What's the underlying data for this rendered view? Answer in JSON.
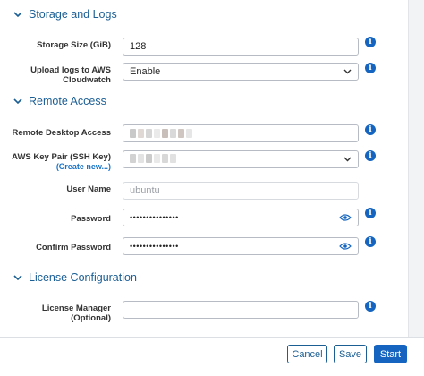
{
  "sections": {
    "storage": "Storage and Logs",
    "remote": "Remote Access",
    "license": "License Configuration"
  },
  "storage": {
    "size_label": "Storage Size (GiB)",
    "size_value": "128",
    "cloudwatch_label": "Upload logs to AWS Cloudwatch",
    "cloudwatch_value": "Enable"
  },
  "remote": {
    "rda_label": "Remote Desktop Access",
    "keypair_label": "AWS Key Pair (SSH Key)",
    "keypair_create": "(Create new...)",
    "username_label": "User Name",
    "username_value": "ubuntu",
    "password_label": "Password",
    "password_value": "•••••••••••••••",
    "confirm_label": "Confirm Password",
    "confirm_value": "•••••••••••••••"
  },
  "license": {
    "manager_label": "License Manager (Optional)",
    "manager_value": ""
  },
  "footer": {
    "cancel": "Cancel",
    "save": "Save",
    "start": "Start"
  },
  "info_glyph": "i",
  "colors": {
    "accent": "#1565c0",
    "section_title": "#1b5e94",
    "link": "#1a73c7"
  },
  "icons": [
    "chevron-down-icon",
    "info-icon",
    "eye-icon",
    "dropdown-caret-icon"
  ]
}
